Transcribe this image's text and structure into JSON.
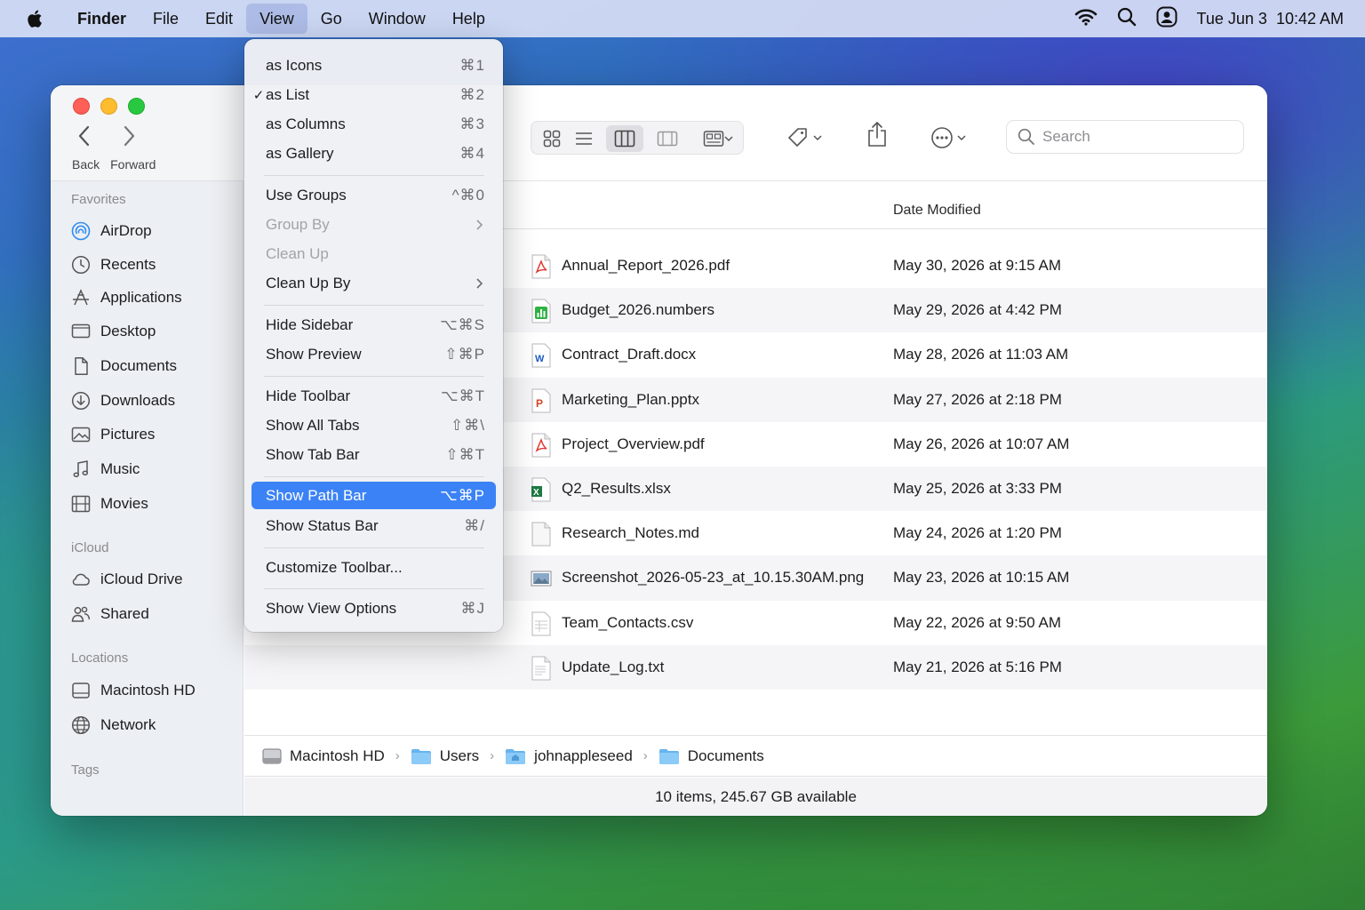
{
  "menubar": {
    "app": "Finder",
    "items": [
      "File",
      "Edit",
      "View",
      "Go",
      "Window",
      "Help"
    ],
    "active": "View",
    "date": "Tue Jun 3",
    "time": "10:42 AM"
  },
  "window": {
    "nav": {
      "back": "Back",
      "forward": "Forward"
    },
    "search_placeholder": "Search",
    "sidebar": {
      "favorites_label": "Favorites",
      "favorites": [
        "AirDrop",
        "Recents",
        "Applications",
        "Desktop",
        "Documents",
        "Downloads",
        "Pictures",
        "Music",
        "Movies"
      ],
      "icloud_label": "iCloud",
      "icloud": [
        "iCloud Drive",
        "Shared"
      ],
      "locations_label": "Locations",
      "locations": [
        "Macintosh HD",
        "Network"
      ],
      "tags_label": "Tags"
    },
    "list": {
      "date_header": "Date Modified",
      "files": [
        {
          "name": "Annual_Report_2026.pdf",
          "date": "May 30, 2026 at 9:15 AM",
          "icon": "pdf-icon"
        },
        {
          "name": "Budget_2026.numbers",
          "date": "May 29, 2026 at 4:42 PM",
          "icon": "numbers-icon"
        },
        {
          "name": "Contract_Draft.docx",
          "date": "May 28, 2026 at 11:03 AM",
          "icon": "word-icon"
        },
        {
          "name": "Marketing_Plan.pptx",
          "date": "May 27, 2026 at 2:18 PM",
          "icon": "powerpoint-icon"
        },
        {
          "name": "Project_Overview.pdf",
          "date": "May 26, 2026 at 10:07 AM",
          "icon": "pdf-icon"
        },
        {
          "name": "Q2_Results.xlsx",
          "date": "May 25, 2026 at 3:33 PM",
          "icon": "excel-icon"
        },
        {
          "name": "Research_Notes.md",
          "date": "May 24, 2026 at 1:20 PM",
          "icon": "document-icon"
        },
        {
          "name": "Screenshot_2026-05-23_at_10.15.30AM.png",
          "date": "May 23, 2026 at 10:15 AM",
          "icon": "image-icon"
        },
        {
          "name": "Team_Contacts.csv",
          "date": "May 22, 2026 at 9:50 AM",
          "icon": "spreadsheet-icon"
        },
        {
          "name": "Update_Log.txt",
          "date": "May 21, 2026 at 5:16 PM",
          "icon": "text-icon"
        }
      ]
    },
    "pathbar": [
      "Macintosh HD",
      "Users",
      "johnappleseed",
      "Documents"
    ],
    "status": "10 items, 245.67 GB available"
  },
  "view_menu": {
    "items": [
      {
        "label": "as Icons",
        "shortcut": "⌘1"
      },
      {
        "label": "as List",
        "shortcut": "⌘2",
        "checked": "✓"
      },
      {
        "label": "as Columns",
        "shortcut": "⌘3"
      },
      {
        "label": "as Gallery",
        "shortcut": "⌘4"
      },
      {
        "label": "Use Groups",
        "shortcut": "^⌘0"
      },
      {
        "label": "Group By",
        "shortcut": ""
      },
      {
        "label": "Clean Up",
        "shortcut": ""
      },
      {
        "label": "Clean Up By",
        "shortcut": ""
      },
      {
        "label": "Hide Sidebar",
        "shortcut": "⌥⌘S"
      },
      {
        "label": "Show Preview",
        "shortcut": "⇧⌘P"
      },
      {
        "label": "Hide Toolbar",
        "shortcut": "⌥⌘T"
      },
      {
        "label": "Show All Tabs",
        "shortcut": "⇧⌘\\"
      },
      {
        "label": "Show Tab Bar",
        "shortcut": "⇧⌘T"
      },
      {
        "label": "Show Path Bar",
        "shortcut": "⌥⌘P"
      },
      {
        "label": "Show Status Bar",
        "shortcut": "⌘/"
      },
      {
        "label": "Customize Toolbar...",
        "shortcut": ""
      },
      {
        "label": "Show View Options",
        "shortcut": "⌘J"
      }
    ]
  }
}
